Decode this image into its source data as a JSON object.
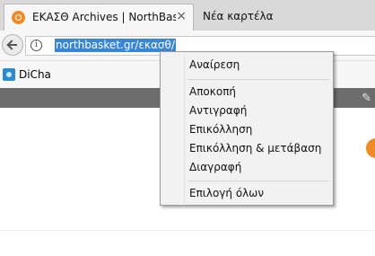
{
  "tabs": [
    {
      "title": "ΕΚΑΣΘ Archives | NorthBasket",
      "active": true,
      "close_label": "×"
    },
    {
      "title": "Νέα καρτέλα",
      "active": false
    }
  ],
  "navbar": {
    "url": "northbasket.gr/εκασθ/",
    "info_glyph": "i"
  },
  "bookmarks": [
    {
      "label": "DiCha"
    }
  ],
  "page": {
    "header_icon_glyph": "✎"
  },
  "context_menu": {
    "items": [
      {
        "label": "Αναίρεση"
      },
      {
        "label": "Αποκοπή"
      },
      {
        "label": "Αντιγραφή"
      },
      {
        "label": "Επικόλληση"
      },
      {
        "label": "Επικόλληση & μετάβαση"
      },
      {
        "label": "Διαγραφή"
      },
      {
        "label": "Επιλογή όλων"
      }
    ]
  },
  "colors": {
    "selection": "#3a86d6",
    "brand_orange": "#f08a24",
    "header_gray": "#6d6d6d"
  }
}
